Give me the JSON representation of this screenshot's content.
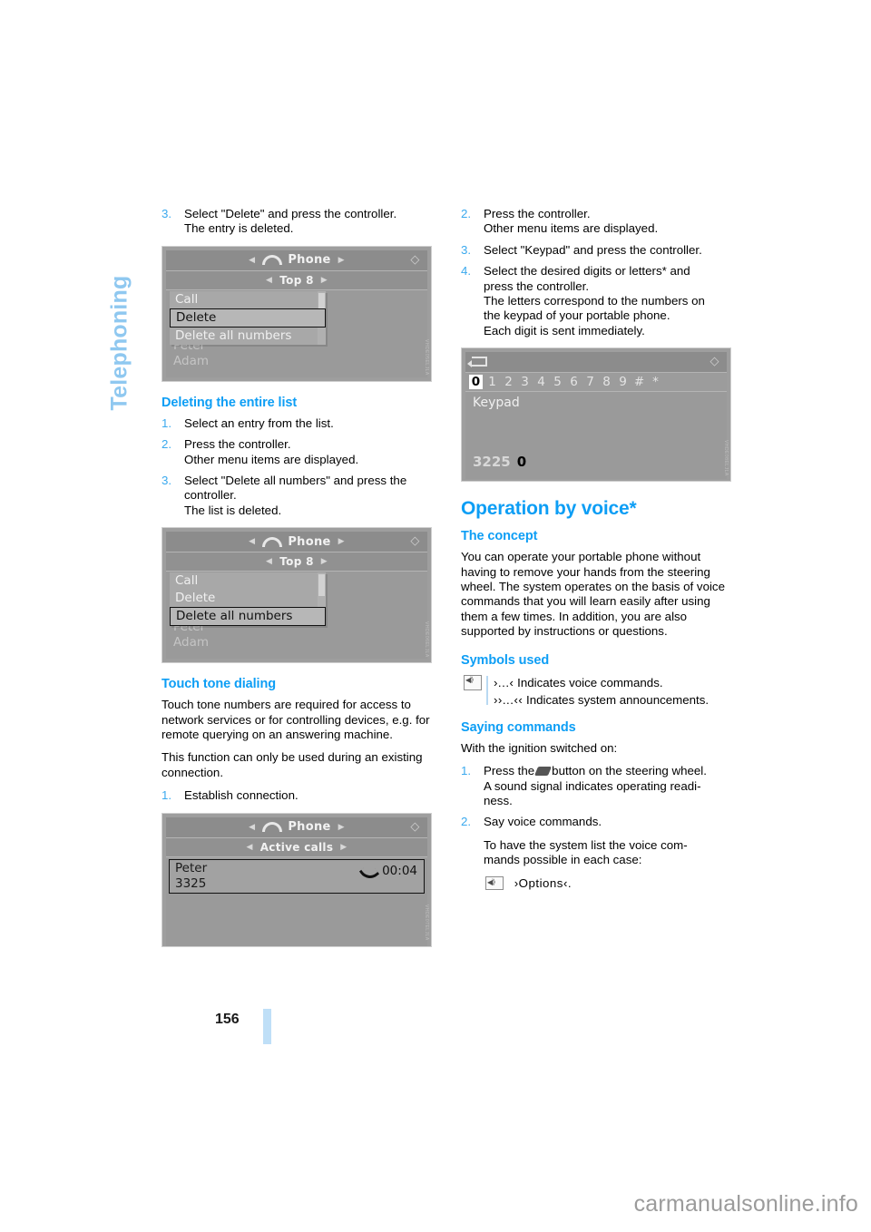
{
  "sidebar": {
    "chapter": "Telephoning"
  },
  "footer": {
    "page_number": "156",
    "watermark": "carmanualsonline.info"
  },
  "left_column": {
    "step3_num": "3.",
    "step3_line1": "Select \"Delete\" and press the controller.",
    "step3_line2": "The entry is deleted.",
    "shot_delete": {
      "title": "Phone",
      "subtitle": "Top 8",
      "menu_items": [
        "Call",
        "Delete",
        "Delete all numbers"
      ],
      "selected_item": "Delete",
      "ghost_entries": [
        "Peter",
        "Adam"
      ],
      "figure_id": "VHDE05ELJLA"
    },
    "heading_delete_list": "Deleting the entire list",
    "del_steps": [
      {
        "num": "1.",
        "lines": [
          "Select an entry from the list."
        ]
      },
      {
        "num": "2.",
        "lines": [
          "Press the controller.",
          "Other menu items are displayed."
        ]
      },
      {
        "num": "3.",
        "lines": [
          "Select \"Delete all numbers\" and press the",
          "controller.",
          "The list is deleted."
        ]
      }
    ],
    "shot_delete_all": {
      "title": "Phone",
      "subtitle": "Top 8",
      "menu_items": [
        "Call",
        "Delete",
        "Delete all numbers"
      ],
      "selected_item": "Delete all numbers",
      "ghost_entries": [
        "Peter",
        "Adam"
      ],
      "figure_id": "VHDE06ELJLA"
    },
    "heading_touch_tone": "Touch tone dialing",
    "touch_p1": "Touch tone numbers are required for access to network services or for controlling devices, e.g. for remote querying on an answering machine.",
    "touch_p2": "This function can only be used during an existing connection.",
    "touch_step1_num": "1.",
    "touch_step1_text": "Establish connection.",
    "shot_active_call": {
      "title": "Phone",
      "subtitle": "Active calls",
      "caller_name": "Peter",
      "caller_number": "3325",
      "duration": "00:04",
      "figure_id": "VHDE07ELJLA"
    }
  },
  "right_column": {
    "steps": [
      {
        "num": "2.",
        "lines": [
          "Press the controller.",
          "Other menu items are displayed."
        ]
      },
      {
        "num": "3.",
        "lines": [
          "Select \"Keypad\" and press the controller."
        ]
      },
      {
        "num": "4.",
        "lines": [
          "Select the desired digits or letters* and",
          "press the controller.",
          "The letters correspond to the numbers on",
          "the keypad of your portable phone.",
          "Each digit is sent immediately."
        ]
      }
    ],
    "shot_keypad": {
      "keys": [
        "0",
        "1",
        "2",
        "3",
        "4",
        "5",
        "6",
        "7",
        "8",
        "9",
        "#",
        "*"
      ],
      "selected_key": "0",
      "title": "Keypad",
      "sent_digits": "3225",
      "current_digit": "0",
      "figure_id": "VHDE08ELJLA"
    },
    "heading_voice": "Operation by voice*",
    "heading_concept": "The concept",
    "concept_text": "You can operate your portable phone without having to remove your hands from the steering wheel. The system operates on the basis of voice commands that you will learn easily after using them a few times. In addition, you are also supported by instructions or questions.",
    "heading_symbols": "Symbols used",
    "symbols": [
      {
        "mark": "›...‹",
        "text": "Indicates voice commands."
      },
      {
        "mark": "››...‹‹",
        "text": "Indicates system announcements."
      }
    ],
    "heading_saying": "Saying commands",
    "saying_intro": "With the ignition switched on:",
    "saying_steps": [
      {
        "num": "1.",
        "pre": "Press the",
        "post": "button on the steering wheel.",
        "extra": [
          "A sound signal indicates operating readi-",
          "ness."
        ]
      },
      {
        "num": "2.",
        "lines": [
          "Say voice commands."
        ],
        "cont": [
          "To have the system list the voice com-",
          "mands possible in each case:"
        ]
      }
    ],
    "options_command": "›Options‹."
  }
}
